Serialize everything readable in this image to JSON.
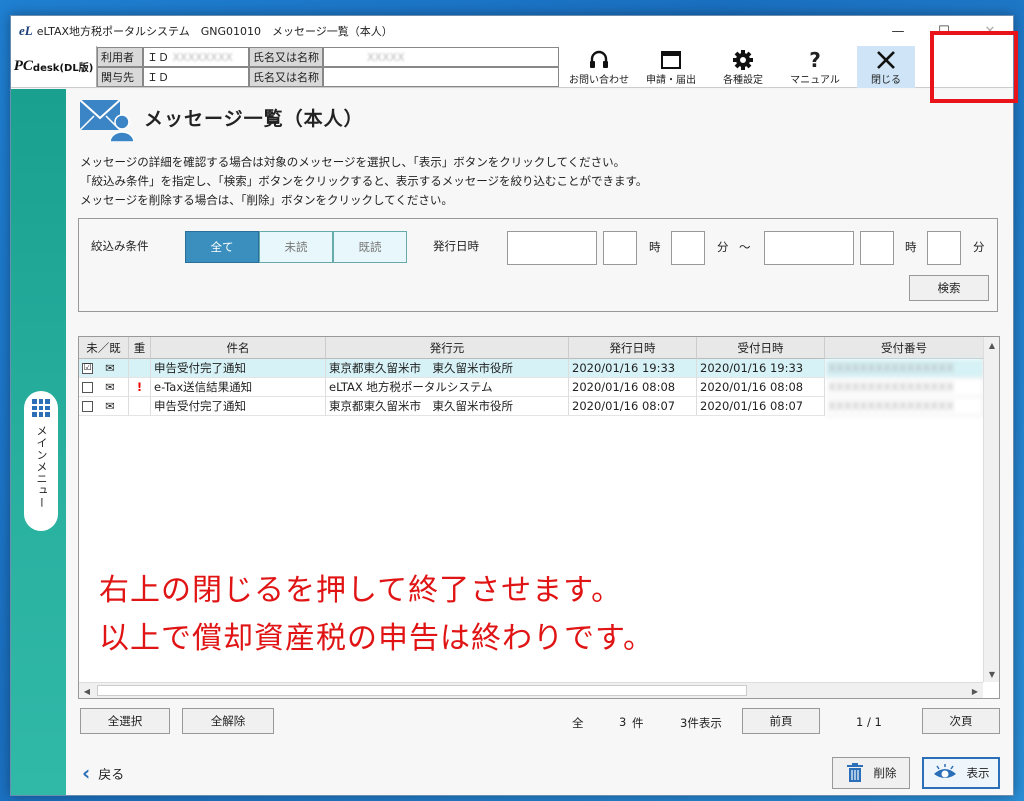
{
  "window": {
    "logo": "eL",
    "title": "eLTAX地方税ポータルシステム　GNG01010　メッセージ一覧（本人）",
    "min": "—",
    "max": "☐",
    "close": "✕"
  },
  "header": {
    "brand": "PC",
    "brand_sub": "desk(DL版)",
    "user_label": "利用者",
    "id_label": "ＩＤ",
    "name_label": "氏名又は名称",
    "rel_label": "関与先",
    "user_id": "XXXXXXXX",
    "user_name": "XXXXX",
    "rel_id": "",
    "rel_name": ""
  },
  "toolbar": {
    "support": "お問い合わせ",
    "apply": "申請・届出",
    "settings": "各種設定",
    "manual": "マニュアル",
    "close": "閉じる"
  },
  "sidebar": {
    "main_menu": "メインメニュー"
  },
  "page": {
    "title": "メッセージ一覧（本人）",
    "desc1": "メッセージの詳細を確認する場合は対象のメッセージを選択し、「表示」ボタンをクリックしてください。",
    "desc2": "「絞込み条件」を指定し、「検索」ボタンをクリックすると、表示するメッセージを絞り込むことができます。",
    "desc3": "メッセージを削除する場合は、「削除」ボタンをクリックしてください。"
  },
  "filter": {
    "label": "絞込み条件",
    "opt_all": "全て",
    "opt_unread": "未読",
    "opt_read": "既読",
    "date_label": "発行日時",
    "hour": "時",
    "minute": "分",
    "tilde": "～",
    "search": "検索"
  },
  "table": {
    "headers": [
      "未／既",
      "重",
      "件名",
      "発行元",
      "発行日時",
      "受付日時",
      "受付番号"
    ],
    "rows": [
      {
        "subject": "申告受付完了通知",
        "issuer": "東京都東久留米市　東久留米市役所",
        "issued": "2020/01/16 19:33",
        "received": "2020/01/16 19:33",
        "number": "XXXXXXXXXXXXXXXX",
        "important": "",
        "checked": "☑"
      },
      {
        "subject": "e-Tax送信結果通知",
        "issuer": "eLTAX 地方税ポータルシステム",
        "issued": "2020/01/16 08:08",
        "received": "2020/01/16 08:08",
        "number": "XXXXXXXXXXXXXXXX",
        "important": "!",
        "checked": ""
      },
      {
        "subject": "申告受付完了通知",
        "issuer": "東京都東久留米市　東久留米市役所",
        "issued": "2020/01/16 08:07",
        "received": "2020/01/16 08:07",
        "number": "XXXXXXXXXXXXXXXX",
        "important": "",
        "checked": ""
      }
    ]
  },
  "overlay": {
    "line1": "右上の閉じるを押して終了させます。",
    "line2": "以上で償却資産税の申告は終わりです。"
  },
  "footer": {
    "select_all": "全選択",
    "clear_all": "全解除",
    "total_label": "全",
    "total_count": "3",
    "unit": "件",
    "shown": "3件表示",
    "prev": "前頁",
    "page": "1 / 1",
    "next": "次頁",
    "back": "戻る",
    "delete": "削除",
    "view": "表示"
  },
  "colors": {
    "accent": "#3b8fbf",
    "highlight": "#e8141a",
    "overlay_text": "#e01414"
  }
}
